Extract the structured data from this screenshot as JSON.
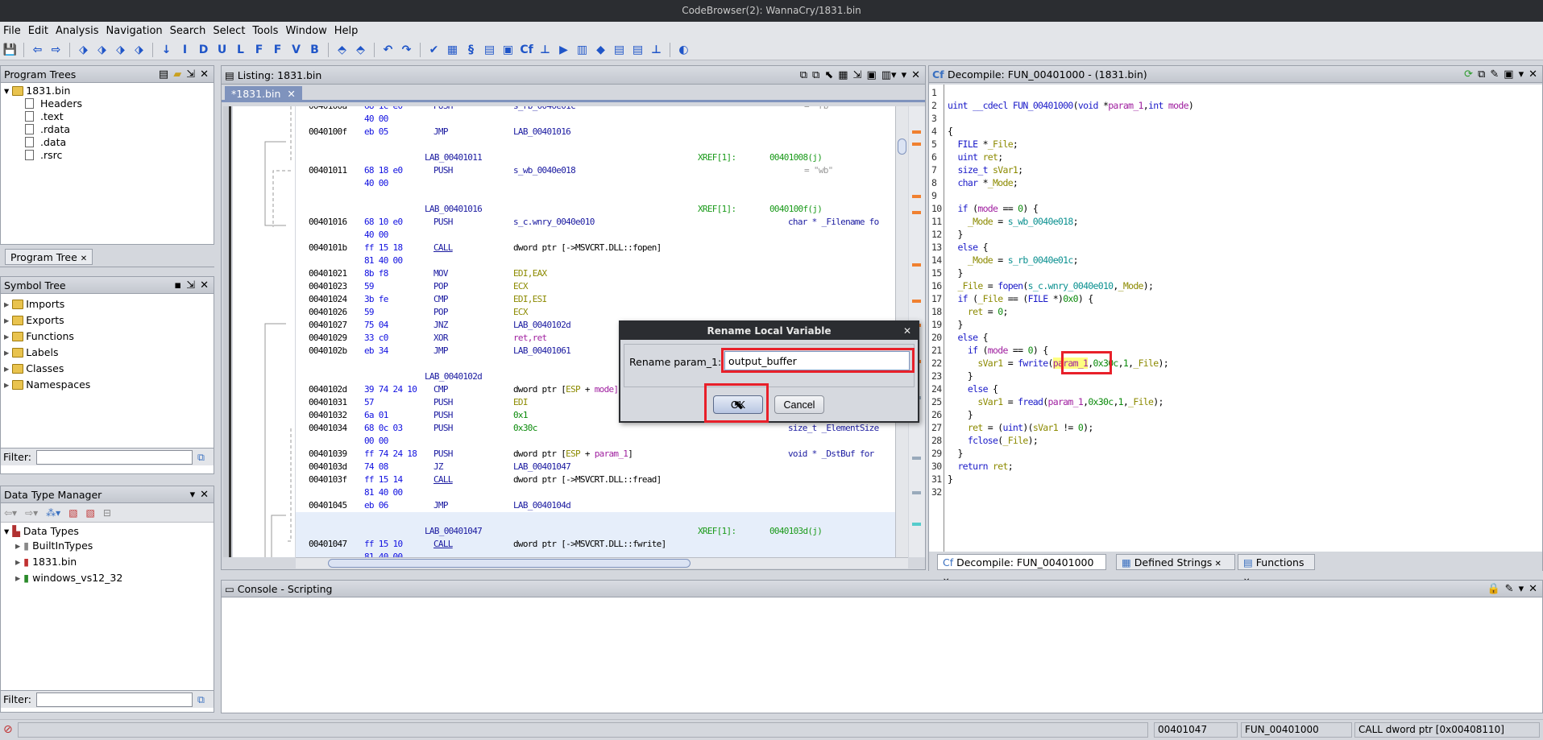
{
  "window": {
    "title": "CodeBrowser(2): WannaCry/1831.bin"
  },
  "menu": [
    "File",
    "Edit",
    "Analysis",
    "Navigation",
    "Search",
    "Select",
    "Tools",
    "Window",
    "Help"
  ],
  "toolbar": [
    {
      "icon": "save-icon",
      "glyph": "💾"
    },
    {
      "sep": true
    },
    {
      "icon": "back-icon",
      "glyph": "⇦"
    },
    {
      "icon": "forward-icon",
      "glyph": "⇨"
    },
    {
      "sep": true
    },
    {
      "icon": "nav-prev-icon",
      "glyph": "⬗"
    },
    {
      "icon": "nav-up-icon",
      "glyph": "⬗"
    },
    {
      "icon": "nav-down-icon",
      "glyph": "⬗"
    },
    {
      "icon": "nav-next-icon",
      "glyph": "⬗"
    },
    {
      "sep": true
    },
    {
      "icon": "next-instruction-icon",
      "glyph": "↓"
    },
    {
      "icon": "next-data-icon",
      "glyph": "I"
    },
    {
      "icon": "next-defined-icon",
      "glyph": "D"
    },
    {
      "icon": "next-undefined-icon",
      "glyph": "U"
    },
    {
      "icon": "next-label-icon",
      "glyph": "L"
    },
    {
      "icon": "next-function-icon",
      "glyph": "F"
    },
    {
      "icon": "next-non-function-icon",
      "glyph": "F"
    },
    {
      "icon": "next-value-icon",
      "glyph": "V"
    },
    {
      "icon": "next-bookmark-icon",
      "glyph": "B"
    },
    {
      "sep": true
    },
    {
      "icon": "merge-icon",
      "glyph": "⬘"
    },
    {
      "icon": "split-icon",
      "glyph": "⬘"
    },
    {
      "sep": true
    },
    {
      "icon": "undo-icon",
      "glyph": "↶"
    },
    {
      "icon": "redo-icon",
      "glyph": "↷"
    },
    {
      "sep": true
    },
    {
      "icon": "checkmark-icon",
      "glyph": "✔"
    },
    {
      "icon": "bytes-icon",
      "glyph": "▦"
    },
    {
      "icon": "script-icon",
      "glyph": "§"
    },
    {
      "icon": "memory-map-icon",
      "glyph": "▤"
    },
    {
      "icon": "data-type-icon",
      "glyph": "▣"
    },
    {
      "icon": "decompiler-icon",
      "glyph": "Cf"
    },
    {
      "icon": "function-graph-icon",
      "glyph": "⊥"
    },
    {
      "icon": "run-icon",
      "glyph": "▶"
    },
    {
      "icon": "registers-icon",
      "glyph": "▥"
    },
    {
      "icon": "diamond-icon",
      "glyph": "◆"
    },
    {
      "icon": "table-icon",
      "glyph": "▤"
    },
    {
      "icon": "export-icon",
      "glyph": "▤"
    },
    {
      "icon": "tree-icon",
      "glyph": "⊥"
    },
    {
      "sep": true
    },
    {
      "icon": "debug-icon",
      "glyph": "◐"
    }
  ],
  "program_trees": {
    "title": "Program Trees",
    "root": "1831.bin",
    "items": [
      "Headers",
      ".text",
      ".rdata",
      ".data",
      ".rsrc"
    ],
    "tab": "Program Tree"
  },
  "symbol_tree": {
    "title": "Symbol Tree",
    "items": [
      "Imports",
      "Exports",
      "Functions",
      "Labels",
      "Classes",
      "Namespaces"
    ],
    "filter_label": "Filter:",
    "filter_value": ""
  },
  "data_type_manager": {
    "title": "Data Type Manager",
    "root": "Data Types",
    "items": [
      "BuiltInTypes",
      "1831.bin",
      "windows_vs12_32"
    ],
    "filter_label": "Filter:",
    "filter_value": ""
  },
  "listing": {
    "title": "Listing:  1831.bin",
    "tab": "*1831.bin",
    "rows": [
      {
        "addr": "0040100a",
        "bytes": "68 1c e0",
        "mn": "PUSH",
        "ops": [
          [
            "s_rb_0040e01c",
            "lab"
          ]
        ],
        "comment": [
          [
            "= \"rb\"",
            "gr"
          ]
        ]
      },
      {
        "bytes": "40 00"
      },
      {
        "addr": "0040100f",
        "bytes": "eb 05",
        "mn": "JMP",
        "ops": [
          [
            "LAB_00401016",
            "lab"
          ]
        ]
      },
      {},
      {
        "label": "LAB_00401011",
        "xref": "XREF[1]:",
        "xref_to": "00401008(j)"
      },
      {
        "addr": "00401011",
        "bytes": "68 18 e0",
        "mn": "PUSH",
        "ops": [
          [
            "s_wb_0040e018",
            "lab"
          ]
        ],
        "comment": [
          [
            "= \"wb\"",
            "gr"
          ]
        ]
      },
      {
        "bytes": "40 00"
      },
      {},
      {
        "label": "LAB_00401016",
        "xref": "XREF[1]:",
        "xref_to": "0040100f(j)"
      },
      {
        "addr": "00401016",
        "bytes": "68 10 e0",
        "mn": "PUSH",
        "ops": [
          [
            "s_c.wnry_0040e010",
            "lab"
          ]
        ],
        "comment": [
          [
            "char * _Filename fo",
            "cm"
          ]
        ]
      },
      {
        "bytes": "40 00"
      },
      {
        "addr": "0040101b",
        "bytes": "ff 15 18",
        "mn": "CALL",
        "call": true,
        "ops": [
          [
            "dword ptr [->MSVCRT.DLL::fopen]",
            "tx"
          ]
        ]
      },
      {
        "bytes": "81 40 00"
      },
      {
        "addr": "00401021",
        "bytes": "8b f8",
        "mn": "MOV",
        "ops": [
          [
            "EDI,EAX",
            "reg"
          ]
        ]
      },
      {
        "addr": "00401023",
        "bytes": "59",
        "mn": "POP",
        "ops": [
          [
            "ECX",
            "reg"
          ]
        ]
      },
      {
        "addr": "00401024",
        "bytes": "3b fe",
        "mn": "CMP",
        "ops": [
          [
            "EDI,ESI",
            "reg"
          ]
        ]
      },
      {
        "addr": "00401026",
        "bytes": "59",
        "mn": "POP",
        "ops": [
          [
            "ECX",
            "reg"
          ]
        ]
      },
      {
        "addr": "00401027",
        "bytes": "75 04",
        "mn": "JNZ",
        "ops": [
          [
            "LAB_0040102d",
            "lab"
          ]
        ]
      },
      {
        "addr": "00401029",
        "bytes": "33 c0",
        "mn": "XOR",
        "ops": [
          [
            "ret,ret",
            "par"
          ]
        ]
      },
      {
        "addr": "0040102b",
        "bytes": "eb 34",
        "mn": "JMP",
        "ops": [
          [
            "LAB_00401061",
            "lab"
          ]
        ]
      },
      {},
      {
        "label": "LAB_0040102d"
      },
      {
        "addr": "0040102d",
        "bytes": "39 74 24 10",
        "mn": "CMP",
        "ops": [
          [
            "dword ptr [",
            "tx"
          ],
          [
            "ESP",
            "reg"
          ],
          [
            " + ",
            "tx"
          ],
          [
            "mode]",
            "par"
          ]
        ]
      },
      {
        "addr": "00401031",
        "bytes": "57",
        "mn": "PUSH",
        "ops": [
          [
            "EDI",
            "reg"
          ]
        ]
      },
      {
        "addr": "00401032",
        "bytes": "6a 01",
        "mn": "PUSH",
        "ops": [
          [
            "0x1",
            "con"
          ]
        ]
      },
      {
        "addr": "00401034",
        "bytes": "68 0c 03",
        "mn": "PUSH",
        "ops": [
          [
            "0x30c",
            "con"
          ]
        ],
        "comment": [
          [
            "size_t _ElementSize",
            "cm"
          ]
        ]
      },
      {
        "bytes": "00 00"
      },
      {
        "addr": "00401039",
        "bytes": "ff 74 24 18",
        "mn": "PUSH",
        "ops": [
          [
            "dword ptr [",
            "tx"
          ],
          [
            "ESP",
            "reg"
          ],
          [
            " + ",
            "tx"
          ],
          [
            "param_1",
            "par"
          ],
          [
            "]",
            "tx"
          ]
        ],
        "comment": [
          [
            "void * _DstBuf for",
            "cm"
          ]
        ]
      },
      {
        "addr": "0040103d",
        "bytes": "74 08",
        "mn": "JZ",
        "ops": [
          [
            "LAB_00401047",
            "lab"
          ]
        ]
      },
      {
        "addr": "0040103f",
        "bytes": "ff 15 14",
        "mn": "CALL",
        "call": true,
        "ops": [
          [
            "dword ptr [->MSVCRT.DLL::fread]",
            "tx"
          ]
        ]
      },
      {
        "bytes": "81 40 00"
      },
      {
        "addr": "00401045",
        "bytes": "eb 06",
        "mn": "JMP",
        "ops": [
          [
            "LAB_0040104d",
            "lab"
          ]
        ]
      },
      {
        "hl": true
      },
      {
        "hl": true,
        "label": "LAB_00401047",
        "xref": "XREF[1]:",
        "xref_to": "0040103d(j)"
      },
      {
        "hl": true,
        "addr": "00401047",
        "bytes": "ff 15 10",
        "mn": "CALL",
        "call": true,
        "ops": [
          [
            "dword ptr [->MSVCRT.DLL::fwrite]",
            "tx"
          ]
        ]
      },
      {
        "hl": true,
        "bytes": "81 40 00"
      }
    ]
  },
  "decompile": {
    "title": "Decompile: FUN_00401000 -  (1831.bin)",
    "lines": [
      [],
      [
        [
          "uint",
          "kw"
        ],
        [
          " __cdecl ",
          "fn"
        ],
        [
          "FUN_00401000",
          "fn"
        ],
        [
          "(",
          "tx"
        ],
        [
          "void",
          "kw"
        ],
        [
          " *",
          "tx"
        ],
        [
          "param_1",
          "par"
        ],
        [
          ",",
          "tx"
        ],
        [
          "int",
          "kw"
        ],
        [
          " ",
          "tx"
        ],
        [
          "mode",
          "par"
        ],
        [
          ")",
          "tx"
        ]
      ],
      [],
      [
        [
          "{",
          "tx"
        ]
      ],
      [
        [
          "  FILE",
          "kw"
        ],
        [
          " *",
          "tx"
        ],
        [
          "_File",
          "lv"
        ],
        [
          ";",
          "tx"
        ]
      ],
      [
        [
          "  uint",
          "kw"
        ],
        [
          " ",
          "tx"
        ],
        [
          "ret",
          "lv"
        ],
        [
          ";",
          "tx"
        ]
      ],
      [
        [
          "  size_t",
          "kw"
        ],
        [
          " ",
          "tx"
        ],
        [
          "sVar1",
          "lv"
        ],
        [
          ";",
          "tx"
        ]
      ],
      [
        [
          "  char",
          "kw"
        ],
        [
          " *",
          "tx"
        ],
        [
          "_Mode",
          "lv"
        ],
        [
          ";",
          "tx"
        ]
      ],
      [],
      [
        [
          "  if",
          "kw"
        ],
        [
          " (",
          "tx"
        ],
        [
          "mode",
          "par"
        ],
        [
          " == ",
          "tx"
        ],
        [
          "0",
          "nm"
        ],
        [
          ") {",
          "tx"
        ]
      ],
      [
        [
          "    _Mode",
          "lv"
        ],
        [
          " = ",
          "tx"
        ],
        [
          "s_wb_0040e018",
          "gv"
        ],
        [
          ";",
          "tx"
        ]
      ],
      [
        [
          "  }",
          "tx"
        ]
      ],
      [
        [
          "  else",
          "kw"
        ],
        [
          " {",
          "tx"
        ]
      ],
      [
        [
          "    _Mode",
          "lv"
        ],
        [
          " = ",
          "tx"
        ],
        [
          "s_rb_0040e01c",
          "gv"
        ],
        [
          ";",
          "tx"
        ]
      ],
      [
        [
          "  }",
          "tx"
        ]
      ],
      [
        [
          "  _File",
          "lv"
        ],
        [
          " = ",
          "tx"
        ],
        [
          "fopen",
          "fn"
        ],
        [
          "(",
          "tx"
        ],
        [
          "s_c.wnry_0040e010",
          "gv"
        ],
        [
          ",",
          "tx"
        ],
        [
          "_Mode",
          "lv"
        ],
        [
          ");",
          "tx"
        ]
      ],
      [
        [
          "  if",
          "kw"
        ],
        [
          " (",
          "tx"
        ],
        [
          "_File",
          "lv"
        ],
        [
          " == (",
          "tx"
        ],
        [
          "FILE",
          "kw"
        ],
        [
          " *)",
          "tx"
        ],
        [
          "0x0",
          "nm"
        ],
        [
          ") {",
          "tx"
        ]
      ],
      [
        [
          "    ret",
          "lv"
        ],
        [
          " = ",
          "tx"
        ],
        [
          "0",
          "nm"
        ],
        [
          ";",
          "tx"
        ]
      ],
      [
        [
          "  }",
          "tx"
        ]
      ],
      [
        [
          "  else",
          "kw"
        ],
        [
          " {",
          "tx"
        ]
      ],
      [
        [
          "    if",
          "kw"
        ],
        [
          " (",
          "tx"
        ],
        [
          "mode",
          "par"
        ],
        [
          " == ",
          "tx"
        ],
        [
          "0",
          "nm"
        ],
        [
          ") {",
          "tx"
        ]
      ],
      [
        [
          "      sVar1",
          "lv"
        ],
        [
          " = ",
          "tx"
        ],
        [
          "fwrite",
          "fn"
        ],
        [
          "(",
          "tx"
        ],
        [
          "param_1",
          "sel"
        ],
        [
          ",",
          "tx"
        ],
        [
          "0x30c",
          "nm"
        ],
        [
          ",",
          "tx"
        ],
        [
          "1",
          "nm"
        ],
        [
          ",",
          "tx"
        ],
        [
          "_File",
          "lv"
        ],
        [
          ");",
          "tx"
        ]
      ],
      [
        [
          "    }",
          "tx"
        ]
      ],
      [
        [
          "    else",
          "kw"
        ],
        [
          " {",
          "tx"
        ]
      ],
      [
        [
          "      sVar1",
          "lv"
        ],
        [
          " = ",
          "tx"
        ],
        [
          "fread",
          "fn"
        ],
        [
          "(",
          "tx"
        ],
        [
          "param_1",
          "par"
        ],
        [
          ",",
          "tx"
        ],
        [
          "0x30c",
          "nm"
        ],
        [
          ",",
          "tx"
        ],
        [
          "1",
          "nm"
        ],
        [
          ",",
          "tx"
        ],
        [
          "_File",
          "lv"
        ],
        [
          ");",
          "tx"
        ]
      ],
      [
        [
          "    }",
          "tx"
        ]
      ],
      [
        [
          "    ret",
          "lv"
        ],
        [
          " = (",
          "tx"
        ],
        [
          "uint",
          "kw"
        ],
        [
          ")(",
          "tx"
        ],
        [
          "sVar1",
          "lv"
        ],
        [
          " != ",
          "tx"
        ],
        [
          "0",
          "nm"
        ],
        [
          ");",
          "tx"
        ]
      ],
      [
        [
          "    fclose",
          "fn"
        ],
        [
          "(",
          "tx"
        ],
        [
          "_File",
          "lv"
        ],
        [
          ");",
          "tx"
        ]
      ],
      [
        [
          "  }",
          "tx"
        ]
      ],
      [
        [
          "  return",
          "kw"
        ],
        [
          " ",
          "tx"
        ],
        [
          "ret",
          "lv"
        ],
        [
          ";",
          "tx"
        ]
      ],
      [
        [
          "}",
          "tx"
        ]
      ],
      []
    ],
    "tabs": [
      "Decompile: FUN_00401000",
      "Defined Strings",
      "Functions"
    ]
  },
  "console": {
    "title": "Console - Scripting"
  },
  "dialog": {
    "title": "Rename Local Variable",
    "label": "Rename param_1:",
    "value": "output_buffer",
    "ok": "OK",
    "cancel": "Cancel"
  },
  "status": {
    "address": "00401047",
    "function": "FUN_00401000",
    "instruction": "CALL dword ptr [0x00408110]"
  },
  "colors": {
    "highlight_box": "#e8202a",
    "selection": "#ffff80",
    "row_highlight": "#e6eefa"
  }
}
